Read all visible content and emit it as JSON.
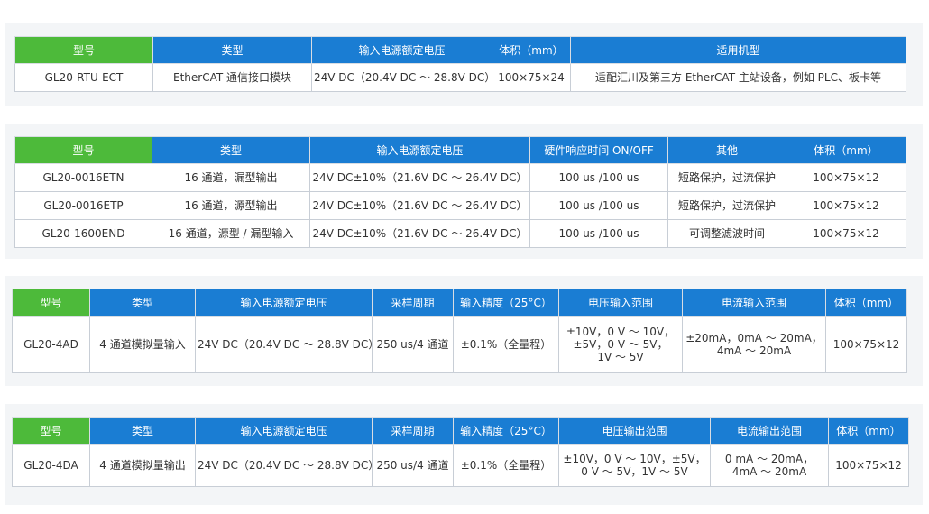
{
  "tables": [
    {
      "headers": [
        "型号",
        "类型",
        "输入电源额定电压",
        "体积（mm）",
        "适用机型"
      ],
      "rows": [
        [
          "GL20-RTU-ECT",
          "EtherCAT 通信接口模块",
          "24V DC（20.4V DC ～ 28.8V DC）",
          "100×75×24",
          "适配汇川及第三方 EtherCAT 主站设备，例如 PLC、板卡等"
        ]
      ]
    },
    {
      "headers": [
        "型号",
        "类型",
        "输入电源额定电压",
        "硬件响应时间 ON/OFF",
        "其他",
        "体积（mm）"
      ],
      "rows": [
        [
          "GL20-0016ETN",
          "16 通道，漏型输出",
          "24V DC±10%（21.6V DC ～ 26.4V DC）",
          "100 us /100 us",
          "短路保护，过流保护",
          "100×75×12"
        ],
        [
          "GL20-0016ETP",
          "16 通道，源型输出",
          "24V DC±10%（21.6V DC ～ 26.4V DC）",
          "100 us /100 us",
          "短路保护，过流保护",
          "100×75×12"
        ],
        [
          "GL20-1600END",
          "16 通道，源型 / 漏型输入",
          "24V DC±10%（21.6V DC ～ 26.4V DC）",
          "100 us /100 us",
          "可调整滤波时间",
          "100×75×12"
        ]
      ]
    },
    {
      "headers": [
        "型号",
        "类型",
        "输入电源额定电压",
        "采样周期",
        "输入精度（25°C）",
        "电压输入范围",
        "电流输入范围",
        "体积（mm）"
      ],
      "rows": [
        [
          "GL20-4AD",
          "4 通道模拟量输入",
          "24V DC（20.4V DC ～ 28.8V DC）",
          "250 us/4 通道",
          "±0.1%（全量程）",
          "±10V，0 V ～ 10V，\n±5V，0 V ～ 5V，\n1V ～ 5V",
          "±20mA，0mA ～ 20mA，\n4mA ～ 20mA",
          "100×75×12"
        ]
      ]
    },
    {
      "headers": [
        "型号",
        "类型",
        "输入电源额定电压",
        "采样周期",
        "输入精度（25°C）",
        "电压输出范围",
        "电流输出范围",
        "体积（mm）"
      ],
      "rows": [
        [
          "GL20-4DA",
          "4 通道模拟量输出",
          "24V DC（20.4V DC ～ 28.8V DC）",
          "250 us/4 通道",
          "±0.1%（全量程）",
          "±10V，0 V ～ 10V，±5V，\n0 V ～ 5V，1V ～ 5V",
          "0 mA ～ 20mA，\n4mA ～ 20mA",
          "100×75×12"
        ]
      ]
    }
  ]
}
